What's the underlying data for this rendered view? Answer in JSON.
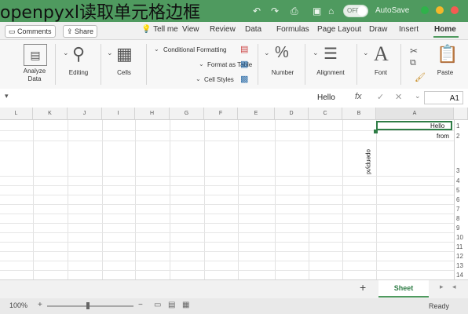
{
  "overlay_title": "openpyxl读取单元格边框",
  "title_bar": {
    "autosave_label": "AutoSave",
    "autosave_state": "OFF",
    "colors": {
      "bar": "#4f9a5f"
    }
  },
  "tabs": [
    {
      "label": "Home",
      "active": true
    },
    {
      "label": "Insert"
    },
    {
      "label": "Draw"
    },
    {
      "label": "Page Layout"
    },
    {
      "label": "Formulas"
    },
    {
      "label": "Data"
    },
    {
      "label": "Review"
    },
    {
      "label": "View"
    },
    {
      "label": "Tell me"
    }
  ],
  "buttons": {
    "share": "Share",
    "comments": "Comments"
  },
  "ribbon": {
    "paste": "Paste",
    "font": "Font",
    "alignment": "Alignment",
    "number": "Number",
    "conditional_formatting": "Conditional Formatting",
    "format_as_table": "Format as Table",
    "cell_styles": "Cell Styles",
    "cells": "Cells",
    "editing": "Editing",
    "analyze_data_line1": "Analyze",
    "analyze_data_line2": "Data"
  },
  "formula_bar": {
    "name_box": "A1",
    "fx": "fx",
    "value": "Hello"
  },
  "columns": [
    "A",
    "B",
    "C",
    "D",
    "E",
    "F",
    "G",
    "H",
    "I",
    "J",
    "K",
    "L"
  ],
  "rows": [
    "1",
    "2",
    "3",
    "4",
    "5",
    "6",
    "7",
    "8",
    "9",
    "10",
    "11",
    "12",
    "13",
    "14"
  ],
  "cells": {
    "A1": "Hello",
    "A2": "from",
    "A3_rotated": "openpyxl"
  },
  "sheet_tab": "Sheet",
  "add_sheet": "+",
  "status": {
    "ready": "Ready",
    "zoom": "100%"
  }
}
